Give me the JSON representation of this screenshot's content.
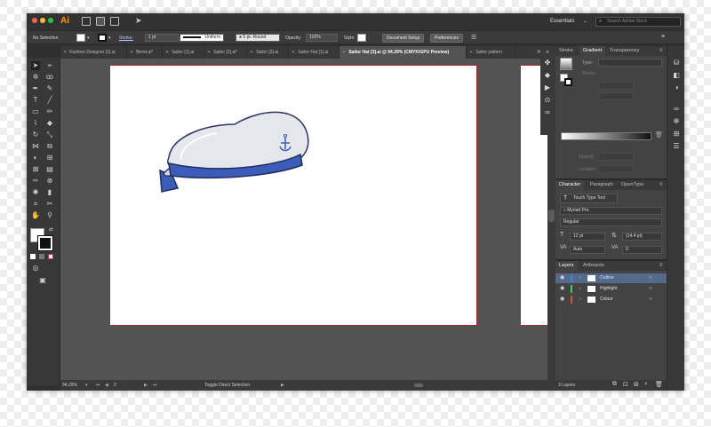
{
  "app": {
    "logo": "Ai",
    "workspace": "Essentials",
    "search_placeholder": "Search Adobe Stock"
  },
  "control_bar": {
    "selection": "No Selection",
    "stroke_label": "Stroke:",
    "stroke_weight": "1 pt",
    "profile": "Uniform",
    "brush": "5 pt. Round",
    "opacity_label": "Opacity:",
    "opacity": "100%",
    "style_label": "Style:",
    "doc_setup": "Document Setup",
    "preferences": "Preferences"
  },
  "tabs": [
    {
      "label": "Fashion Designer [1].ai"
    },
    {
      "label": "Beret.ai*"
    },
    {
      "label": "Sailor [1].ai"
    },
    {
      "label": "Sailor [2].ai*"
    },
    {
      "label": "Sailor [3].ai"
    },
    {
      "label": "Sailor Hat [1].ai"
    },
    {
      "label": "Sailor Hat [3].ai @ 94.29% (CMYK/GPU Preview)"
    },
    {
      "label": "Sailor pattern"
    }
  ],
  "status_bar": {
    "zoom": "94.29%",
    "page": "2",
    "tool_hint": "Toggle Direct Selection"
  },
  "panels": {
    "top_tabs": [
      "Stroke",
      "Gradient",
      "Transparency"
    ],
    "gradient": {
      "type_label": "Type:",
      "stroke_label": "Stroke:",
      "opacity_label": "Opacity:",
      "location_label": "Location:"
    },
    "char_tabs": [
      "Character",
      "Paragraph",
      "OpenType"
    ],
    "character": {
      "touch_type": "Touch Type Tool",
      "font": "Myriad Pro",
      "style": "Regular",
      "size": "12 pt",
      "leading": "(14.4 pt)",
      "kerning": "Auto",
      "tracking": "0"
    },
    "layer_tabs": [
      "Layers",
      "Artboards"
    ],
    "layers": [
      {
        "name": "Outline",
        "color": "#4a7fd8"
      },
      {
        "name": "Highlight",
        "color": "#3bd14a"
      },
      {
        "name": "Colour",
        "color": "#e04848"
      }
    ],
    "layer_count": "3 Layers"
  }
}
